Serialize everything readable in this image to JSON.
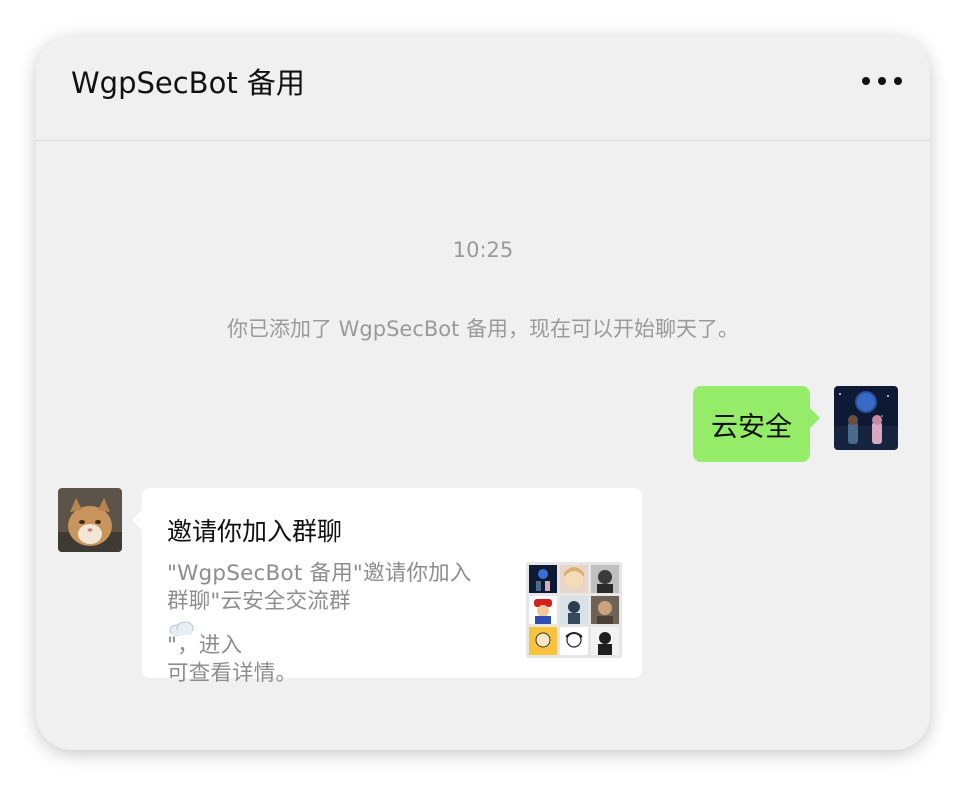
{
  "header": {
    "title": "WgpSecBot 备用",
    "more_icon": "more-dots-icon"
  },
  "chat": {
    "timestamp": "10:25",
    "system_message": "你已添加了 WgpSecBot 备用，现在可以开始聊天了。",
    "messages": [
      {
        "type": "text",
        "direction": "sent",
        "text": "云安全",
        "bubble_color": "#95ec69"
      },
      {
        "type": "group-invite-card",
        "direction": "received",
        "title": "邀请你加入群聊",
        "description_lines": [
          "\"WgpSecBot 备用\"邀请你加入",
          "群聊\"云安全交流群",
          "\"，进入",
          "可查看详情。"
        ],
        "cloud_icon": "cloud-icon"
      }
    ]
  },
  "colors": {
    "background": "#f0f0f0",
    "sent_bubble": "#95ec69",
    "received_bubble": "#ffffff",
    "muted_text": "#9a9a9a"
  }
}
